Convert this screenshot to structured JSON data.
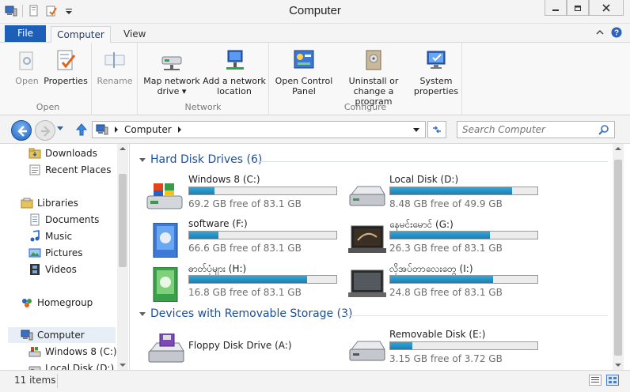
{
  "window": {
    "title": "Computer"
  },
  "ribbon_tabs": {
    "file": "File",
    "computer": "Computer",
    "view": "View"
  },
  "ribbon": {
    "groups": {
      "open": "Open",
      "network": "Network",
      "configure": "Configure"
    },
    "buttons": {
      "open": "Open",
      "properties": "Properties",
      "rename": "Rename",
      "map_drive_1": "Map network",
      "map_drive_2": "drive ▾",
      "add_location_1": "Add a network",
      "add_location_2": "location",
      "control_panel_1": "Open Control",
      "control_panel_2": "Panel",
      "uninstall_1": "Uninstall or",
      "uninstall_2": "change a program",
      "system_props_1": "System",
      "system_props_2": "properties"
    }
  },
  "address": {
    "path": "Computer"
  },
  "search": {
    "placeholder": "Search Computer"
  },
  "nav": {
    "downloads": "Downloads",
    "recent": "Recent Places",
    "libraries": "Libraries",
    "documents": "Documents",
    "music": "Music",
    "pictures": "Pictures",
    "videos": "Videos",
    "homegroup": "Homegroup",
    "computer": "Computer",
    "win8c": "Windows 8 (C:)",
    "locald": "Local Disk (D:)"
  },
  "sections": {
    "hdd": "Hard Disk Drives (6)",
    "removable": "Devices with Removable Storage (3)"
  },
  "drives": [
    {
      "name": "Windows 8 (C:)",
      "free": "69.2 GB free of 83.1 GB",
      "used_fraction": 0.17
    },
    {
      "name": "Local Disk (D:)",
      "free": "8.48 GB free of 49.9 GB",
      "used_fraction": 0.83
    },
    {
      "name": "software (F:)",
      "free": "66.6 GB free of 83.1 GB",
      "used_fraction": 0.2
    },
    {
      "name": "နေမင်းမောင် (G:)",
      "free": "26.3 GB free of 83.1 GB",
      "used_fraction": 0.68
    },
    {
      "name": "ဓာတ်ပုံများ (H:)",
      "free": "16.8 GB free of 83.1 GB",
      "used_fraction": 0.8
    },
    {
      "name": "လိုအပ်တာလေးတွေ (I:)",
      "free": "24.8 GB free of 83.1 GB",
      "used_fraction": 0.7
    }
  ],
  "removable": [
    {
      "name": "Floppy Disk Drive (A:)"
    },
    {
      "name": "Removable Disk (E:)",
      "free": "3.15 GB free of 3.72 GB",
      "used_fraction": 0.15
    }
  ],
  "status": {
    "items": "11 items"
  },
  "colors": {
    "accent": "#1d5fb8",
    "bar_fill": "#2fa9d9",
    "section_heading": "#1b4f9b"
  }
}
